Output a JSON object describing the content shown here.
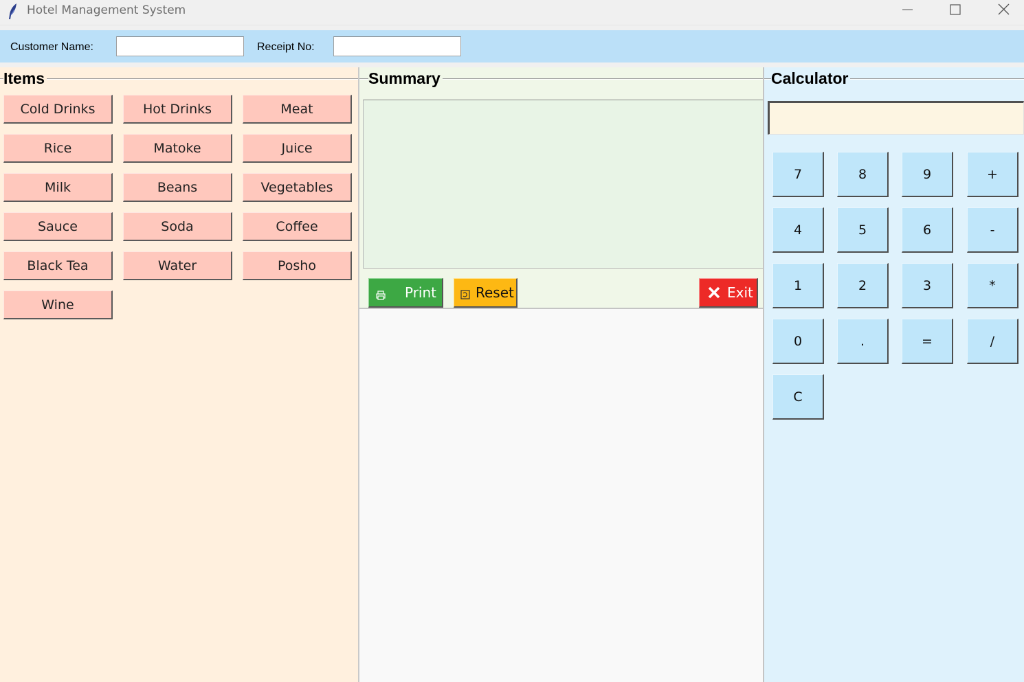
{
  "window": {
    "title": "Hotel Management System",
    "icon": "feather-icon"
  },
  "header": {
    "customer_label": "Customer Name:",
    "customer_value": "",
    "receipt_label": "Receipt No:",
    "receipt_value": ""
  },
  "items": {
    "title": "Items",
    "buttons": [
      "Cold Drinks",
      "Hot Drinks",
      "Meat",
      "Rice",
      "Matoke",
      "Juice",
      "Milk",
      "Beans",
      "Vegetables",
      "Sauce",
      "Soda",
      "Coffee",
      "Black Tea",
      "Water",
      "Posho",
      "Wine"
    ]
  },
  "summary": {
    "title": "Summary",
    "text": "",
    "print_label": "Print",
    "reset_label": "Reset",
    "exit_label": "Exit"
  },
  "calculator": {
    "title": "Calculator",
    "display": "",
    "keys": [
      "7",
      "8",
      "9",
      "+",
      "4",
      "5",
      "6",
      "-",
      "1",
      "2",
      "3",
      "*",
      "0",
      ".",
      "=",
      "/",
      "C"
    ]
  },
  "colors": {
    "header_bg": "#bbe0f8",
    "items_bg": "#fff0de",
    "item_button": "#ffc8bd",
    "summary_bg": "#f0f7e8",
    "calc_bg": "#dff2fc",
    "calc_button": "#bfe6fa",
    "print": "#3da844",
    "reset": "#fdb813",
    "exit": "#ed2a27"
  }
}
